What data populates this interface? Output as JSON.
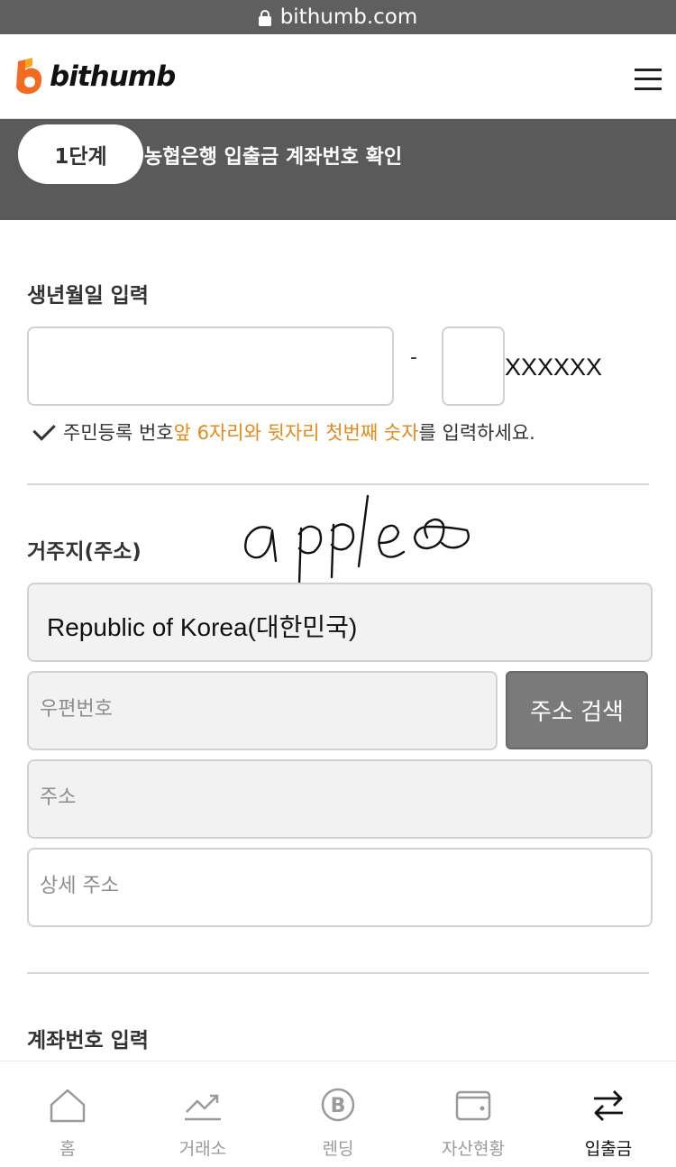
{
  "browser": {
    "url": "bithumb.com"
  },
  "header": {
    "logo_text": "bithumb",
    "menu_icon": "hamburger-menu-icon"
  },
  "step": {
    "badge": "1단계",
    "title": "농협은행 입출금 계좌번호 확인"
  },
  "birth": {
    "title": "생년월일 입력",
    "birth_value": "",
    "first_digit_value": "",
    "separator": "-",
    "masked": "XXXXXX",
    "hint_prefix": "주민등록 번호 ",
    "hint_highlight": "앞 6자리와 뒷자리 첫번째 숫자",
    "hint_suffix": "를 입력하세요."
  },
  "address": {
    "title": "거주지(주소)",
    "country": "Republic of Korea(대한민국)",
    "zip_placeholder": "우편번호",
    "search_button": "주소 검색",
    "address_placeholder": "주소",
    "detail_placeholder": "상세 주소"
  },
  "account": {
    "title": "계좌번호 입력"
  },
  "bottom_nav": [
    {
      "label": "홈",
      "icon": "home-icon",
      "active": false
    },
    {
      "label": "거래소",
      "icon": "chart-trend-icon",
      "active": false
    },
    {
      "label": "렌딩",
      "icon": "bitcoin-coin-icon",
      "active": false
    },
    {
      "label": "자산현황",
      "icon": "wallet-icon",
      "active": false
    },
    {
      "label": "입출금",
      "icon": "transfer-arrows-icon",
      "active": true
    }
  ],
  "colors": {
    "accent": "#e48a1a",
    "brand": "#f26b21",
    "step_bar": "#5a5a5a"
  }
}
